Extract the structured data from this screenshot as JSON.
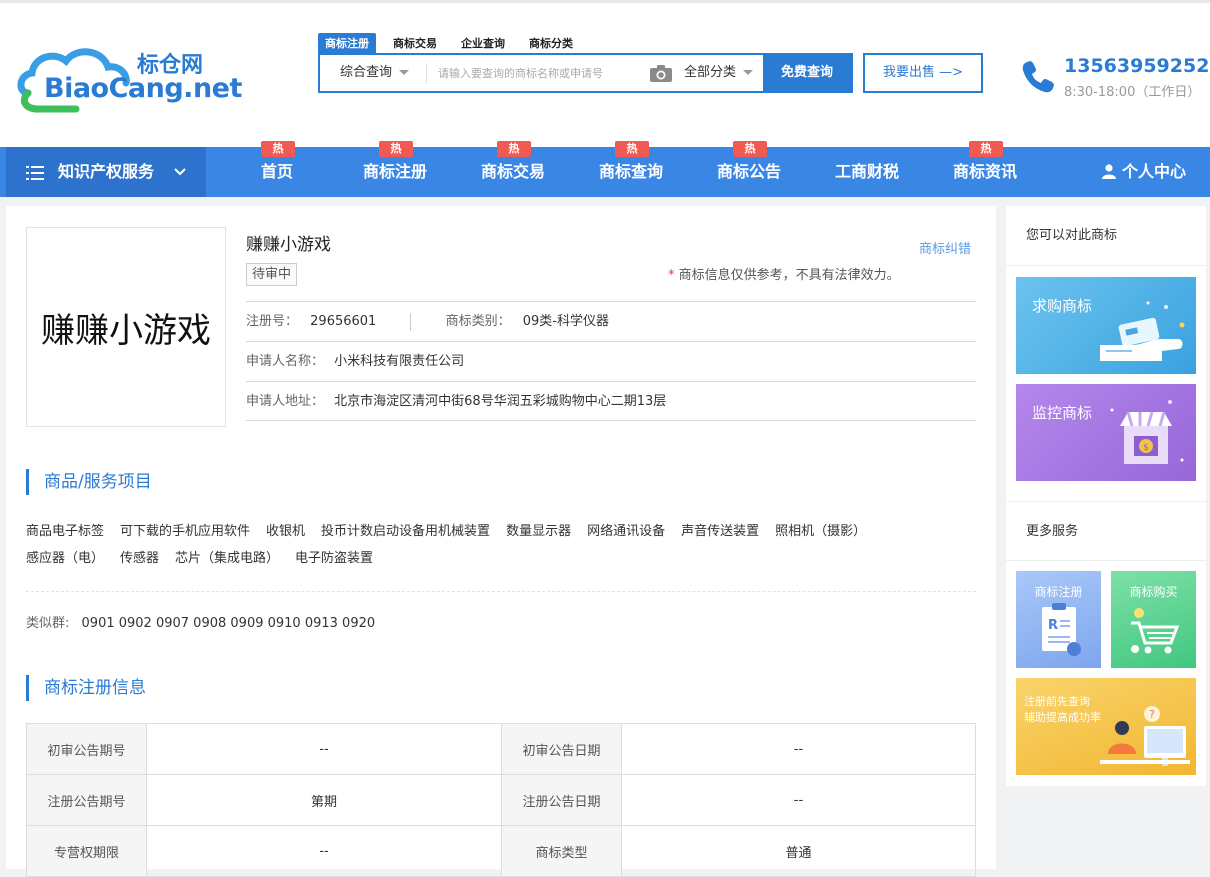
{
  "logo": {
    "cn": "标仓网",
    "en": "BiaoCang.net"
  },
  "search": {
    "tabs": [
      "商标注册",
      "商标交易",
      "企业查询",
      "商标分类"
    ],
    "active_tab": "商标注册",
    "type_select": "综合查询",
    "placeholder": "请输入要查询的商标名称或申请号",
    "category_select": "全部分类",
    "button": "免费查询"
  },
  "sell_button": "我要出售 —>",
  "contact": {
    "phone": "13563959252",
    "hours": "8:30-18:00（工作日）"
  },
  "nav": {
    "category_label": "知识产权服务",
    "hot_label": "热",
    "items": [
      "首页",
      "商标注册",
      "商标交易",
      "商标查询",
      "商标公告",
      "工商财税",
      "商标资讯"
    ],
    "user": "个人中心"
  },
  "trademark": {
    "image_text": "赚赚小游戏",
    "name": "赚赚小游戏",
    "status": "待审中",
    "correction_link": "商标纠错",
    "disclaimer": "商标信息仅供参考，不具有法律效力。",
    "reg_no_label": "注册号：",
    "reg_no": "29656601",
    "class_label": "商标类别：",
    "class": "09类-科学仪器",
    "applicant_label": "申请人名称：",
    "applicant": "小米科技有限责任公司",
    "address_label": "申请人地址：",
    "address": "北京市海淀区清河中街68号华润五彩城购物中心二期13层"
  },
  "goods_section": {
    "title": "商品/服务项目",
    "items": [
      "商品电子标签",
      "可下载的手机应用软件",
      "收银机",
      "投币计数启动设备用机械装置",
      "数量显示器",
      "网络通讯设备",
      "声音传送装置",
      "照相机（摄影）",
      "感应器（电）",
      "传感器",
      "芯片（集成电路）",
      "电子防盗装置"
    ],
    "similar_label": "类似群:",
    "similar_groups": "0901 0902 0907 0908 0909 0910 0913 0920"
  },
  "reg_section": {
    "title": "商标注册信息",
    "rows": [
      [
        "初审公告期号",
        "--",
        "初审公告日期",
        "--"
      ],
      [
        "注册公告期号",
        "第期",
        "注册公告日期",
        "--"
      ],
      [
        "专营权期限",
        "--",
        "商标类型",
        "普通"
      ]
    ]
  },
  "sidebar": {
    "heading": "您可以对此商标",
    "buy_card": "求购商标",
    "monitor_card": "监控商标",
    "more_heading": "更多服务",
    "tile_register": "商标注册",
    "tile_buy": "商标购买",
    "promo_line1": "注册前先查询",
    "promo_line2": "辅助提高成功率"
  },
  "colors": {
    "brand": "#2a7bd3",
    "nav": "#3a86e4",
    "hot": "#f05a52"
  }
}
